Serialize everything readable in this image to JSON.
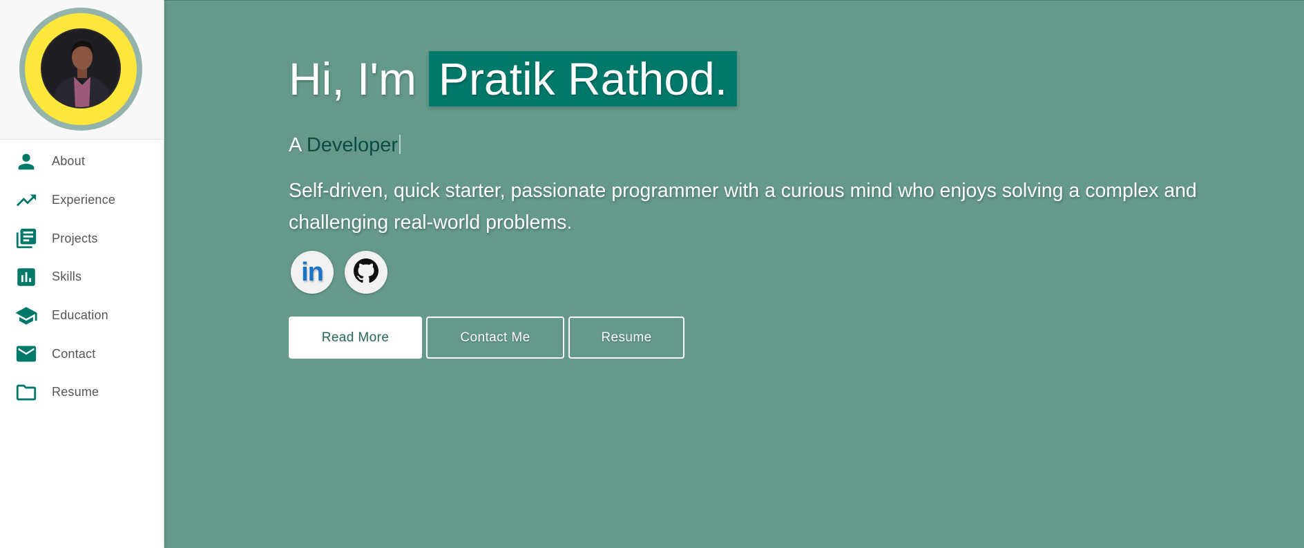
{
  "sidebar": {
    "avatar_alt": "Profile photo",
    "items": [
      {
        "label": "About",
        "icon": "person-icon"
      },
      {
        "label": "Experience",
        "icon": "trending-up-icon"
      },
      {
        "label": "Projects",
        "icon": "library-books-icon"
      },
      {
        "label": "Skills",
        "icon": "bar-chart-icon"
      },
      {
        "label": "Education",
        "icon": "graduation-cap-icon"
      },
      {
        "label": "Contact",
        "icon": "mail-icon"
      },
      {
        "label": "Resume",
        "icon": "folder-icon"
      }
    ]
  },
  "hero": {
    "greeting": "Hi, I'm",
    "name": "Pratik Rathod.",
    "subtitle_prefix": "A",
    "role": "Developer",
    "description": "Self-driven, quick starter, passionate programmer with a curious mind who enjoys solving a complex and challenging real-world problems.",
    "socials": [
      {
        "name": "LinkedIn",
        "glyph": "in",
        "icon": "linkedin-icon"
      },
      {
        "name": "GitHub",
        "icon": "github-icon"
      }
    ],
    "buttons": {
      "read_more": "Read More",
      "contact": "Contact Me",
      "resume": "Resume"
    }
  },
  "colors": {
    "accent": "#00796b",
    "hero_background": "#64998b",
    "avatar_ring": "#94b3ac",
    "avatar_fill": "#fde73a",
    "role_text": "#0c4b41",
    "linkedin": "#1a73c4"
  }
}
